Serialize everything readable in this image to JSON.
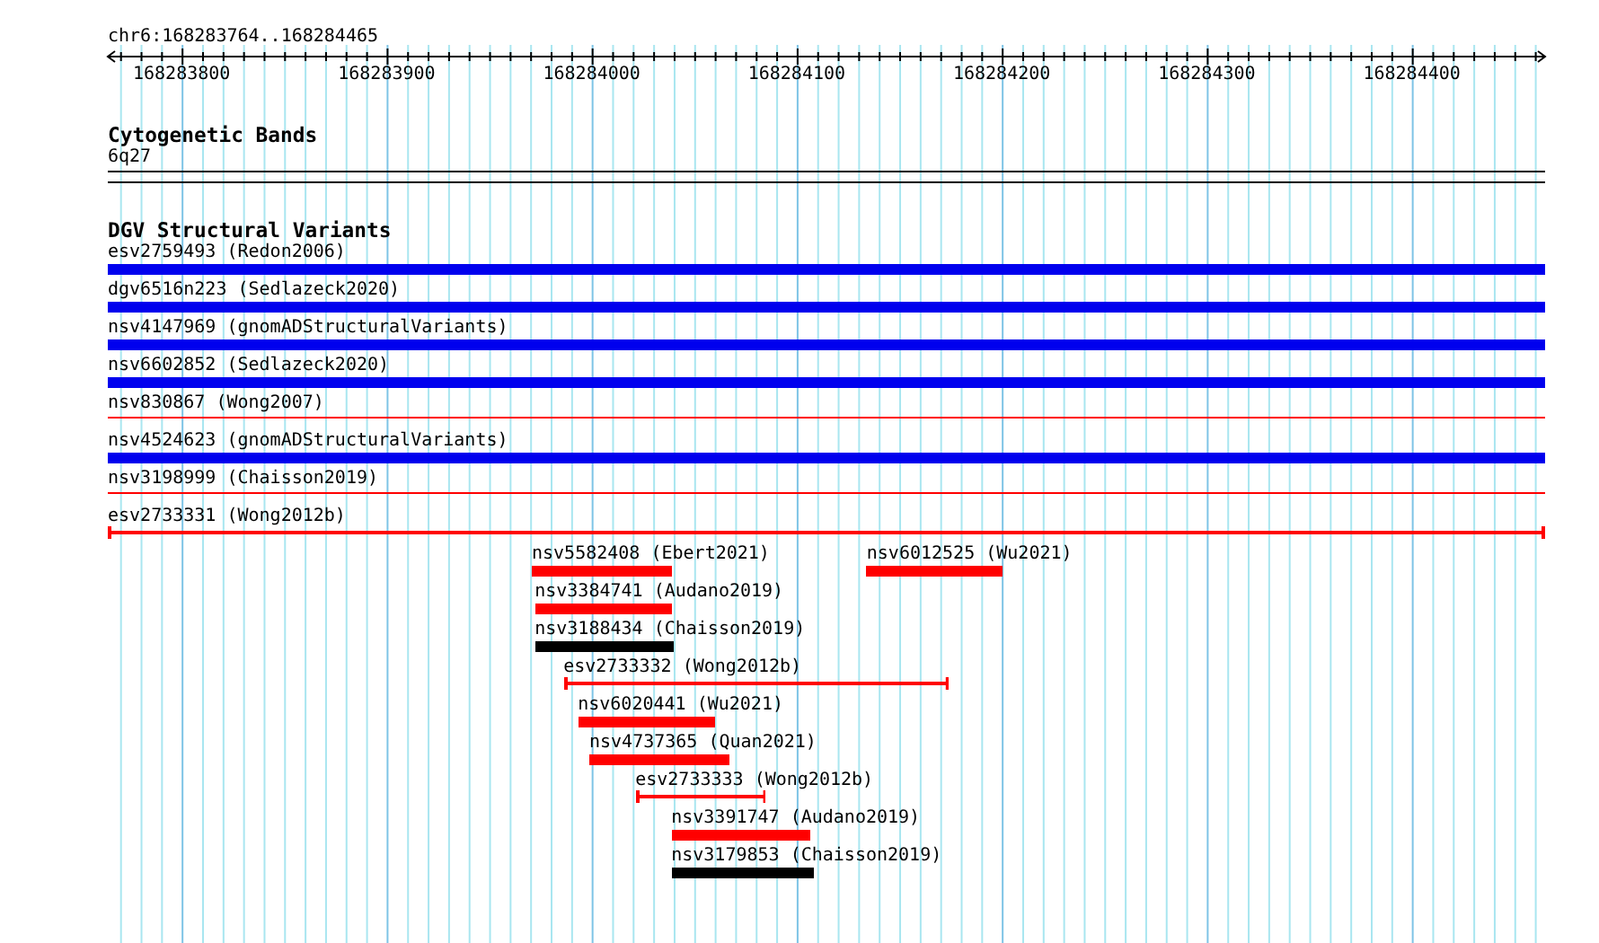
{
  "location": "chr6:168283764..168284465",
  "ruler": {
    "ticks": [
      "168283800",
      "168283900",
      "168284000",
      "168284100",
      "168284200",
      "168284300",
      "168284400"
    ]
  },
  "tracks": [
    {
      "title": "Cytogenetic Bands",
      "rows": [
        [
          {
            "label": "6q27",
            "kind": "thin",
            "color": "#000000"
          }
        ]
      ]
    },
    {
      "title": "DGV Structural Variants",
      "rows": [
        [
          {
            "label": "esv2759493 (Redon2006)",
            "kind": "bar",
            "color": "#0000ee"
          }
        ],
        [
          {
            "label": "dgv6516n223 (Sedlazeck2020)",
            "kind": "bar",
            "color": "#0000ee"
          }
        ],
        [
          {
            "label": "nsv4147969 (gnomADStructuralVariants)",
            "kind": "bar",
            "color": "#0000ee"
          }
        ],
        [
          {
            "label": "nsv6602852 (Sedlazeck2020)",
            "kind": "bar",
            "color": "#0000ee"
          }
        ],
        [
          {
            "label": "nsv830867 (Wong2007)",
            "kind": "thin",
            "color": "#ff0000"
          }
        ],
        [
          {
            "label": "nsv4524623 (gnomADStructuralVariants)",
            "kind": "bar",
            "color": "#0000ee"
          }
        ],
        [
          {
            "label": "nsv3198999 (Chaisson2019)",
            "kind": "thin",
            "color": "#ff0000"
          }
        ],
        [
          {
            "label": "esv2733331 (Wong2012b)",
            "kind": "interval",
            "color": "#ff0000"
          }
        ],
        [
          {
            "label": "nsv5582408 (Ebert2021)",
            "kind": "bar",
            "color": "#ff0000"
          },
          {
            "label": "nsv6012525 (Wu2021)",
            "kind": "bar",
            "color": "#ff0000"
          }
        ],
        [
          {
            "label": "nsv3384741 (Audano2019)",
            "kind": "bar",
            "color": "#ff0000"
          }
        ],
        [
          {
            "label": "nsv3188434 (Chaisson2019)",
            "kind": "bar",
            "color": "#000000"
          }
        ],
        [
          {
            "label": "esv2733332 (Wong2012b)",
            "kind": "interval",
            "color": "#ff0000"
          }
        ],
        [
          {
            "label": "nsv6020441 (Wu2021)",
            "kind": "bar",
            "color": "#ff0000"
          }
        ],
        [
          {
            "label": "nsv4737365 (Quan2021)",
            "kind": "bar",
            "color": "#ff0000"
          }
        ],
        [
          {
            "label": "esv2733333 (Wong2012b)",
            "kind": "interval",
            "color": "#ff0000"
          }
        ],
        [
          {
            "label": "nsv3391747 (Audano2019)",
            "kind": "bar",
            "color": "#ff0000"
          }
        ],
        [
          {
            "label": "nsv3179853 (Chaisson2019)",
            "kind": "bar",
            "color": "#000000"
          }
        ]
      ]
    }
  ]
}
